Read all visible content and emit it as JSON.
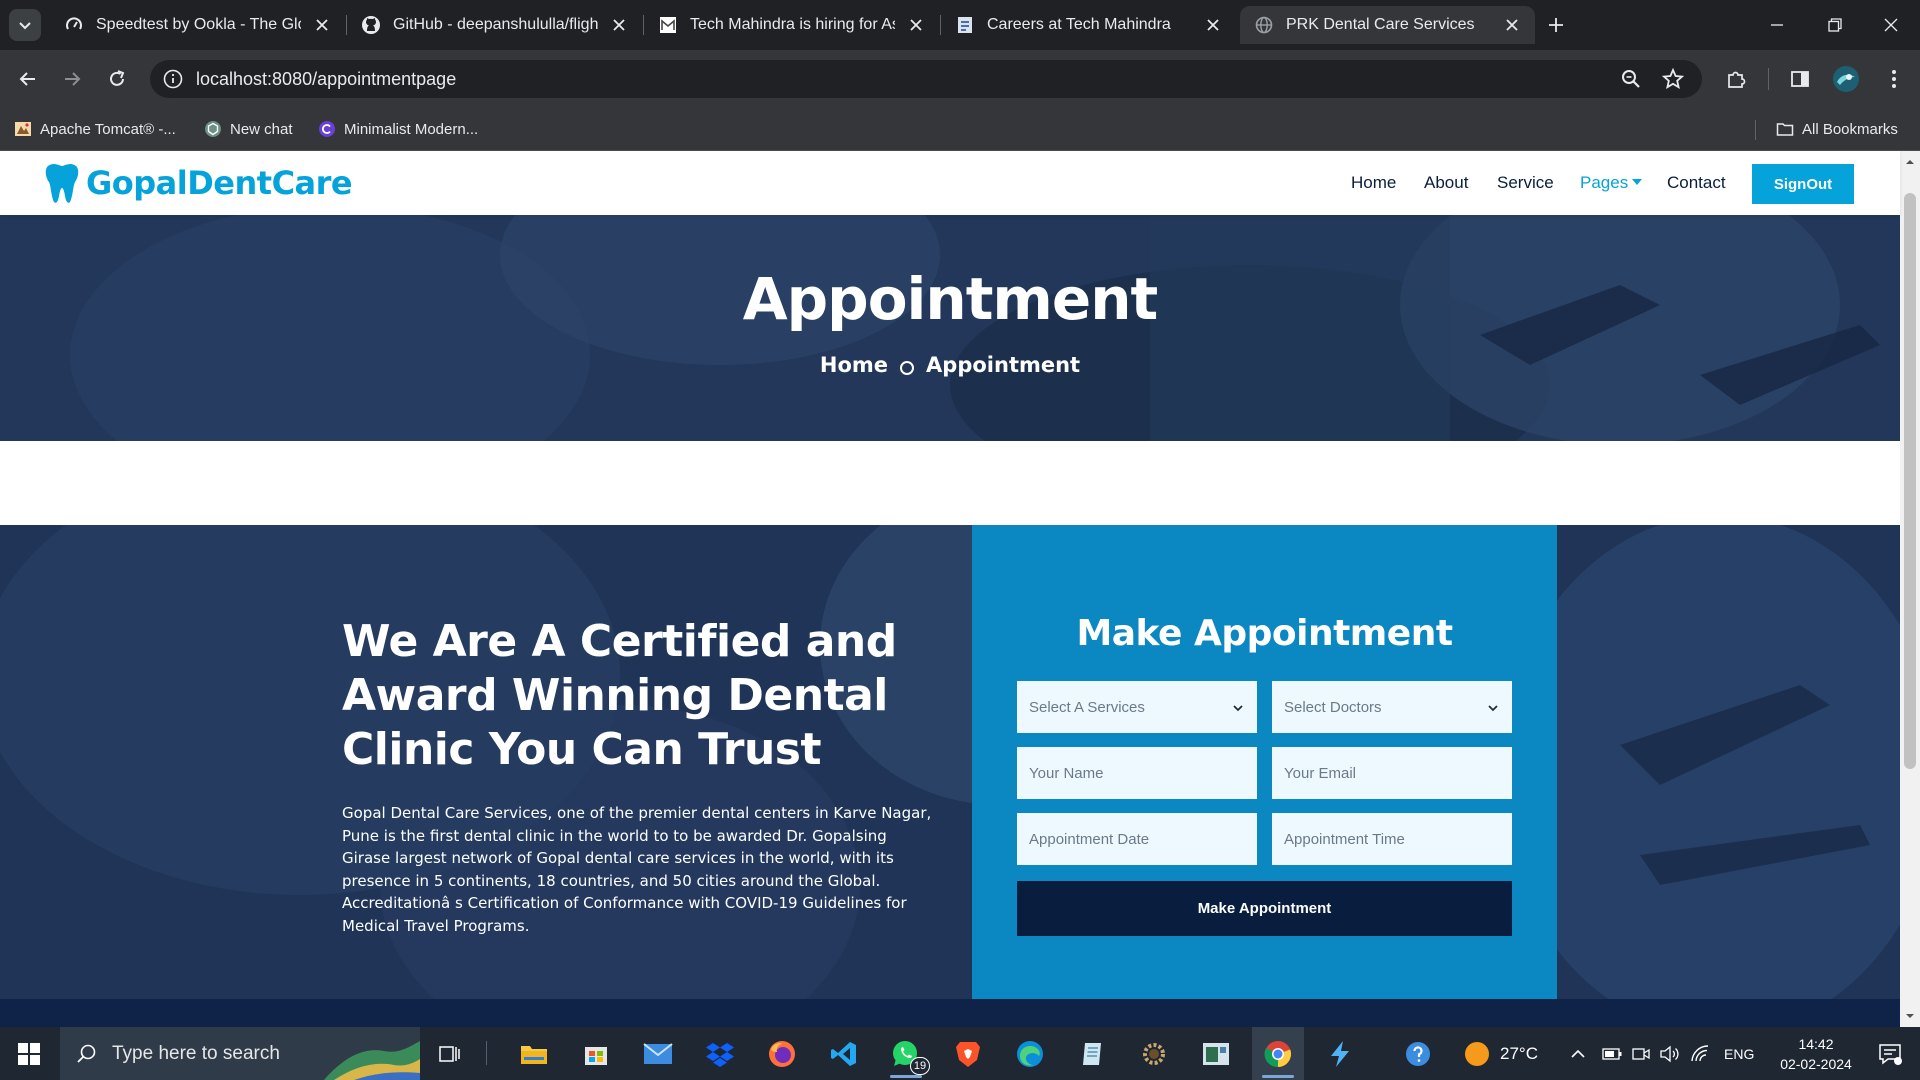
{
  "browser": {
    "tabs": [
      {
        "title": "Speedtest by Ookla - The Global Broadband Speed Test",
        "favicon": "speedtest-icon",
        "active": false
      },
      {
        "title": "GitHub - deepanshululla/flight-booking",
        "favicon": "github-icon",
        "active": false
      },
      {
        "title": "Tech Mahindra is hiring for Associate",
        "favicon": "gmail-icon",
        "active": false
      },
      {
        "title": "Careers at Tech Mahindra",
        "favicon": "document-icon",
        "active": false
      },
      {
        "title": "PRK Dental Care Services",
        "favicon": "globe-icon",
        "active": true
      }
    ],
    "url": "localhost:8080/appointmentpage",
    "bookmarks": [
      {
        "label": "Apache Tomcat® -...",
        "icon": "tomcat-icon"
      },
      {
        "label": "New chat",
        "icon": "chatgpt-icon"
      },
      {
        "label": "Minimalist Modern...",
        "icon": "canva-icon"
      }
    ],
    "all_bookmarks": "All Bookmarks"
  },
  "site": {
    "logo": "GopalDentCare",
    "nav": [
      "Home",
      "About",
      "Service",
      "Pages",
      "Contact"
    ],
    "signout": "SignOut",
    "accent_color": "#06a3da",
    "dark_color": "#091e3e"
  },
  "hero": {
    "title": "Appointment",
    "breadcrumb": [
      "Home",
      "Appointment"
    ]
  },
  "about": {
    "heading": "We Are A Certified and Award Winning Dental Clinic You Can Trust",
    "paragraph": "Gopal Dental Care Services, one of the premier dental centers in Karve Nagar, Pune is the first dental clinic in the world to to be awarded Dr. Gopalsing Girase largest network of Gopal dental care services in the world, with its presence in 5 continents, 18 countries, and 50 cities around the Global. Accreditationâ s Certification of Conformance with COVID-19 Guidelines for Medical Travel Programs."
  },
  "form": {
    "title": "Make Appointment",
    "service_select": "Select A Services",
    "doctor_select": "Select Doctors",
    "name_placeholder": "Your Name",
    "email_placeholder": "Your Email",
    "date_placeholder": "Appointment Date",
    "time_placeholder": "Appointment Time",
    "submit": "Make Appointment"
  },
  "taskbar": {
    "search_placeholder": "Type here to search",
    "apps": [
      "task-view",
      "file-explorer",
      "microsoft-store",
      "mail",
      "dropbox",
      "firefox",
      "vscode",
      "whatsapp",
      "brave",
      "edge",
      "notepad-plus",
      "settings",
      "terminal",
      "chrome",
      "app-bolt",
      "help"
    ],
    "whatsapp_badge": "19",
    "weather": "27°C",
    "language": "ENG",
    "time": "14:42",
    "date": "02-02-2024"
  }
}
